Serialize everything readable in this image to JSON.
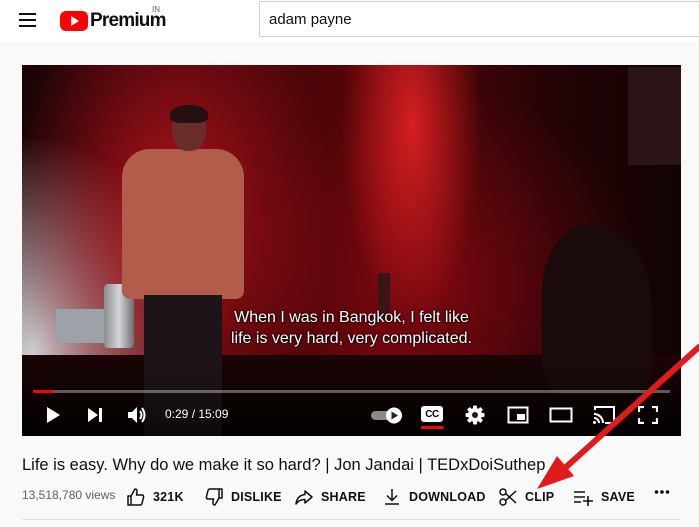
{
  "header": {
    "logo_text": "Premium",
    "country_code": "IN",
    "search_value": "adam payne"
  },
  "player": {
    "subtitle_line1": "When I was in Bangkok, I felt like",
    "subtitle_line2": "life is very hard, very complicated.",
    "time_display": "0:29 / 15:09",
    "progress_fraction": 0.032,
    "cc_label": "CC"
  },
  "video": {
    "title": "Life is easy. Why do we make it so hard? | Jon Jandai | TEDxDoiSuthep",
    "views": "13,518,780 views"
  },
  "actions": {
    "like": "321K",
    "dislike": "DISLIKE",
    "share": "SHARE",
    "download": "DOWNLOAD",
    "clip": "CLIP",
    "save": "SAVE"
  },
  "colors": {
    "brand_red": "#ff0000",
    "annotation_arrow": "#e01b1b"
  }
}
